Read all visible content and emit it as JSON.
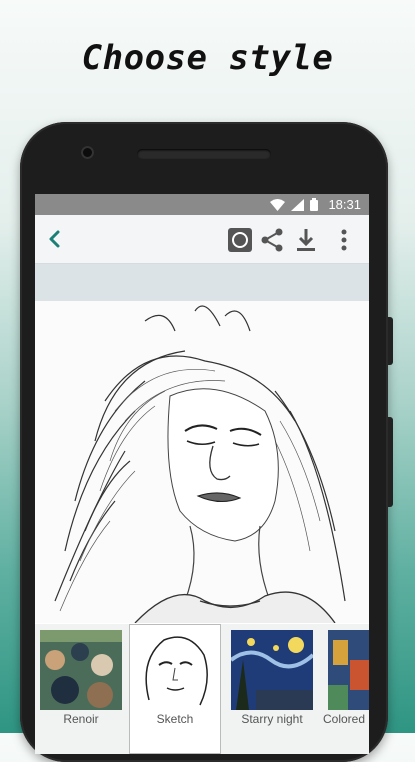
{
  "headline": "Choose style",
  "status_bar": {
    "time": "18:31"
  },
  "app_bar": {
    "back_icon": "chevron-left-icon",
    "actions": [
      "camera-icon",
      "share-icon",
      "download-icon",
      "more-vert-icon"
    ]
  },
  "styles": [
    {
      "label": "Renoir",
      "selected": false
    },
    {
      "label": "Sketch",
      "selected": true
    },
    {
      "label": "Starry night",
      "selected": false
    },
    {
      "label": "Colored",
      "selected": false
    }
  ],
  "colors": {
    "accent": "#1a7f76",
    "status_bar": "#8a8a8a",
    "app_bar": "#f3f5f6"
  }
}
